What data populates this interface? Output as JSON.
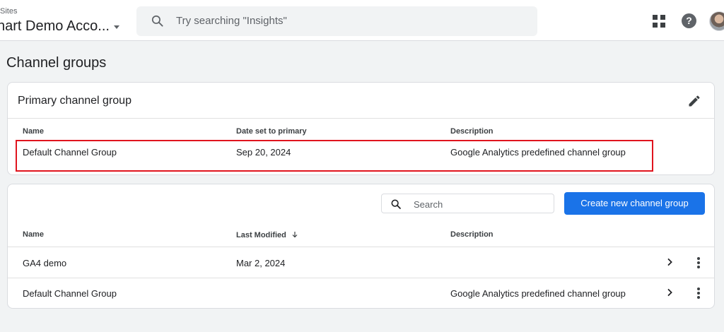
{
  "header": {
    "account_sub": "Sites",
    "account_name": "nart Demo Acco...",
    "search_placeholder": "Try searching \"Insights\""
  },
  "page": {
    "title": "Channel groups"
  },
  "primary_card": {
    "title": "Primary channel group",
    "columns": [
      "Name",
      "Date set to primary",
      "Description"
    ],
    "row": {
      "name": "Default Channel Group",
      "date": "Sep 20, 2024",
      "description": "Google Analytics predefined channel group"
    }
  },
  "list_card": {
    "search_placeholder": "Search",
    "create_label": "Create new channel group",
    "columns": [
      "Name",
      "Last Modified",
      "Description"
    ],
    "rows": [
      {
        "name": "GA4 demo",
        "modified": "Mar 2, 2024",
        "description": ""
      },
      {
        "name": "Default Channel Group",
        "modified": "",
        "description": "Google Analytics predefined channel group"
      }
    ]
  },
  "colors": {
    "accent": "#1a73e8",
    "highlight": "#e0141e"
  },
  "icons": [
    "search-icon",
    "apps-icon",
    "help-icon",
    "pencil-icon",
    "arrow-down-icon",
    "chevron-right-icon",
    "more-vert-icon"
  ]
}
